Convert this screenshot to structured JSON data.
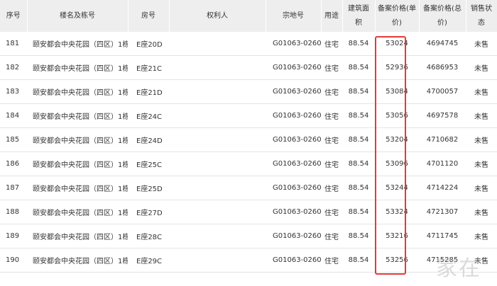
{
  "headers": {
    "no": "序号",
    "building": "楼名及栋号",
    "room": "房号",
    "owner": "权利人",
    "lot": "宗地号",
    "use": "用途",
    "area_l1": "建筑面",
    "area_l2": "积",
    "unit_l1": "备案价格(单",
    "unit_l2": "价)",
    "total_l1": "备案价格(总",
    "total_l2": "价)",
    "status": "销售状态"
  },
  "rows": [
    {
      "no": "181",
      "building": "颐安都会中央花园（四区）1栋",
      "room": "E座20D",
      "owner": "",
      "lot": "G01063-0260",
      "use": "住宅",
      "area": "88.54",
      "unit_price": "53024",
      "total_price": "4694745",
      "status": "未售"
    },
    {
      "no": "182",
      "building": "颐安都会中央花园（四区）1栋",
      "room": "E座21C",
      "owner": "",
      "lot": "G01063-0260",
      "use": "住宅",
      "area": "88.54",
      "unit_price": "52936",
      "total_price": "4686953",
      "status": "未售"
    },
    {
      "no": "183",
      "building": "颐安都会中央花园（四区）1栋",
      "room": "E座21D",
      "owner": "",
      "lot": "G01063-0260",
      "use": "住宅",
      "area": "88.54",
      "unit_price": "53084",
      "total_price": "4700057",
      "status": "未售"
    },
    {
      "no": "184",
      "building": "颐安都会中央花园（四区）1栋",
      "room": "E座24C",
      "owner": "",
      "lot": "G01063-0260",
      "use": "住宅",
      "area": "88.54",
      "unit_price": "53056",
      "total_price": "4697578",
      "status": "未售"
    },
    {
      "no": "185",
      "building": "颐安都会中央花园（四区）1栋",
      "room": "E座24D",
      "owner": "",
      "lot": "G01063-0260",
      "use": "住宅",
      "area": "88.54",
      "unit_price": "53204",
      "total_price": "4710682",
      "status": "未售"
    },
    {
      "no": "186",
      "building": "颐安都会中央花园（四区）1栋",
      "room": "E座25C",
      "owner": "",
      "lot": "G01063-0260",
      "use": "住宅",
      "area": "88.54",
      "unit_price": "53096",
      "total_price": "4701120",
      "status": "未售"
    },
    {
      "no": "187",
      "building": "颐安都会中央花园（四区）1栋",
      "room": "E座25D",
      "owner": "",
      "lot": "G01063-0260",
      "use": "住宅",
      "area": "88.54",
      "unit_price": "53244",
      "total_price": "4714224",
      "status": "未售"
    },
    {
      "no": "188",
      "building": "颐安都会中央花园（四区）1栋",
      "room": "E座27D",
      "owner": "",
      "lot": "G01063-0260",
      "use": "住宅",
      "area": "88.54",
      "unit_price": "53324",
      "total_price": "4721307",
      "status": "未售"
    },
    {
      "no": "189",
      "building": "颐安都会中央花园（四区）1栋",
      "room": "E座28C",
      "owner": "",
      "lot": "G01063-0260",
      "use": "住宅",
      "area": "88.54",
      "unit_price": "53216",
      "total_price": "4711745",
      "status": "未售"
    },
    {
      "no": "190",
      "building": "颐安都会中央花园（四区）1栋",
      "room": "E座29C",
      "owner": "",
      "lot": "G01063-0260",
      "use": "住宅",
      "area": "88.54",
      "unit_price": "53256",
      "total_price": "4715285",
      "status": "未售"
    }
  ],
  "watermark": "家在",
  "colors": {
    "highlight": "#e53935",
    "header_bg": "#eeeeee",
    "row_border": "#e4e4e4"
  }
}
